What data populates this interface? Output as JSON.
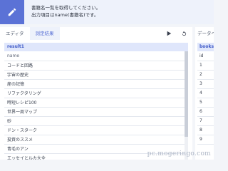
{
  "banner": {
    "line1": "書籍名一覧を取得してください。",
    "line2": "出力項目はname(書籍名)です。"
  },
  "tabs": [
    {
      "label": "エディタ"
    },
    {
      "label": "測定結果"
    }
  ],
  "result": {
    "set_label": "result1",
    "column": "name",
    "rows": [
      "コードと回路",
      "宇宙の歴史",
      "産の記憶",
      "リファクタリング",
      "時短レシピ100",
      "世界一周マップ",
      "砂",
      "ドン・スターク",
      "投資のススメ",
      "青毛のアン",
      "エッセイとルカ大全"
    ]
  },
  "right": {
    "tab_label": "データベース",
    "table_label": "books",
    "column": "id",
    "rows": [
      "1",
      "2",
      "3",
      "4",
      "5",
      "6",
      "7",
      "8",
      "9"
    ]
  },
  "watermark": "pc.mogeringo.com"
}
